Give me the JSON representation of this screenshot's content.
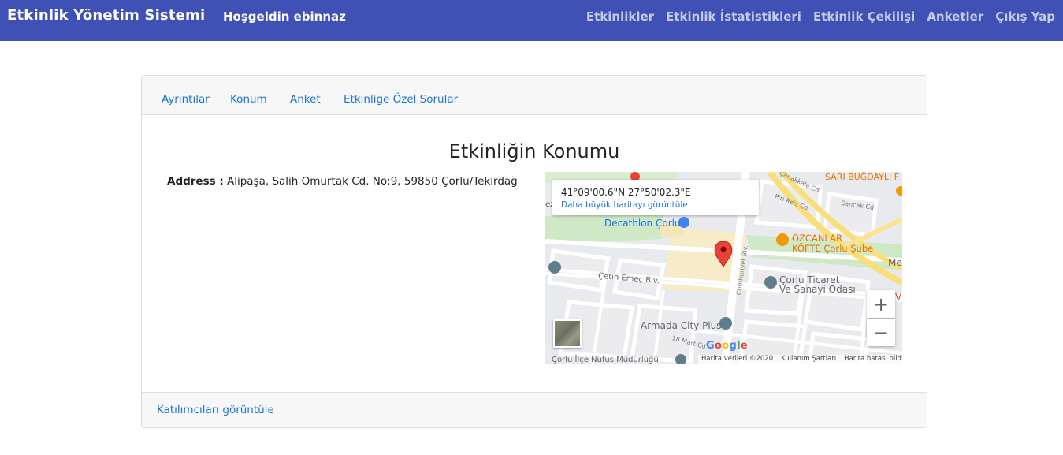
{
  "navbar": {
    "brand": "Etkinlik Yönetim Sistemi",
    "welcome": "Hoşgeldin ebinnaz",
    "links": [
      "Etkinlikler",
      "Etkinlik İstatistikleri",
      "Etkinlik Çekilişi",
      "Anketler",
      "Çıkış Yap"
    ],
    "bg_color": "#3f51b5"
  },
  "tabs": [
    "Ayrıntılar",
    "Konum",
    "Anket",
    "Etkinliğe Özel Sorular"
  ],
  "section": {
    "title": "Etkinliğin Konumu",
    "address_label": "Address :",
    "address_value": "Alipaşa, Salih Omurtak Cd. No:9, 59850 Çorlu/Tekirdağ"
  },
  "map": {
    "coords": "41°09'00.6\"N 27°50'02.3\"E",
    "larger_map_link": "Daha büyük haritayı görüntüle",
    "places": {
      "decathlon": "Decathlon Çorlu",
      "ozcanlar_1": "ÖZCANLAR",
      "ozcanlar_2": "KÖFTE Çorlu Şube",
      "ticaret_1": "Çorlu Ticaret",
      "ticaret_2": "Ve Sanayi Odası",
      "armada": "Armada City Plus",
      "sari": "SARI BUĞDAYLI F",
      "cetin": "Çetin Emeç Blv.",
      "cumhuriyet": "Cumhuriyet Blv.",
      "nufus": "Çorlu İlçe Nüfus Müdürlüğü",
      "mar": "18 Mart Cd.",
      "me": "Me",
      "v": "V",
      "ez": "ez",
      "piri": "Piri Reis Cd",
      "sancak": "Sancak Cd",
      "cnm": "Çanakkale Cd"
    },
    "zoom_in": "+",
    "zoom_out": "−",
    "google": [
      "G",
      "o",
      "o",
      "g",
      "l",
      "e"
    ],
    "footer": [
      "Harita verileri ©2020",
      "Kullanım Şartları",
      "Harita hatası bildirin"
    ]
  },
  "footer": {
    "link": "Katılımcıları görüntüle"
  }
}
